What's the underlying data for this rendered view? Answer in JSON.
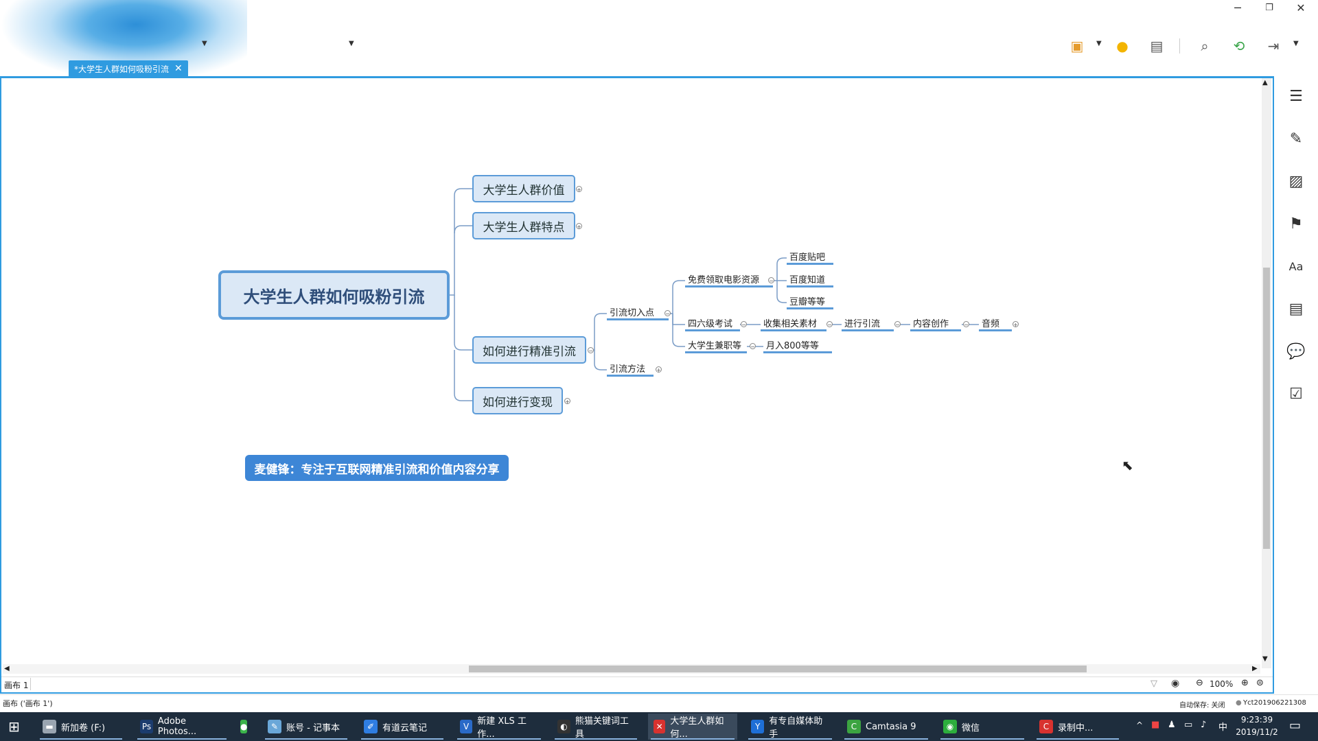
{
  "window": {
    "controls": [
      "─",
      "❐",
      "✕"
    ]
  },
  "tab": {
    "title": "*大学生人群如何吸粉引流",
    "close": "✕"
  },
  "mindmap": {
    "root": "大学生人群如何吸粉引流",
    "branches": [
      "大学生人群价值",
      "大学生人群特点",
      "如何进行精准引流",
      "如何进行变现"
    ],
    "sub": {
      "yinliu_rukou": "引流切入点",
      "yinliu_fangfa": "引流方法",
      "mianfei": "免费领取电影资源",
      "baidu_tieba": "百度贴吧",
      "baidu_zhidao": "百度知道",
      "douban": "豆瓣等等",
      "siliuji": "四六级考试",
      "shouji": "收集相关素材",
      "jinxing": "进行引流",
      "neirong": "内容创作",
      "yinpin": "音频",
      "jianzhi": "大学生兼职等",
      "yueru": "月入800等等"
    },
    "callout": "麦健锋：专注于互联网精准引流和价值内容分享"
  },
  "sheet": {
    "tab_label": "画布 1",
    "zoom": "100%"
  },
  "status": {
    "left": "画布 ('画布 1')",
    "autosave": "自动保存: 关闭",
    "user": "Yct201906221308"
  },
  "taskbar": {
    "items": [
      {
        "label": "新加卷 (F:)",
        "icon_color": "#9aa5b1",
        "glyph": "▬"
      },
      {
        "label": "Adobe Photos...",
        "icon_color": "#1c3c6e",
        "glyph": "Ps"
      },
      {
        "label": "",
        "icon_color": "#3bb34a",
        "glyph": "●"
      },
      {
        "label": "账号 - 记事本",
        "icon_color": "#6aa7d8",
        "glyph": "✎"
      },
      {
        "label": "有道云笔记",
        "icon_color": "#2f7de1",
        "glyph": "✐"
      },
      {
        "label": "新建 XLS 工作...",
        "icon_color": "#2a6ac8",
        "glyph": "V"
      },
      {
        "label": "熊猫关键词工具",
        "icon_color": "#333333",
        "glyph": "◐"
      },
      {
        "label": "大学生人群如何...",
        "icon_color": "#d8322f",
        "glyph": "✕"
      },
      {
        "label": "有专自媒体助手",
        "icon_color": "#1e6fd6",
        "glyph": "Y"
      },
      {
        "label": "Camtasia 9",
        "icon_color": "#3ca441",
        "glyph": "C"
      },
      {
        "label": "微信",
        "icon_color": "#2dae3d",
        "glyph": "◉"
      },
      {
        "label": "录制中...",
        "icon_color": "#d8322f",
        "glyph": "C"
      }
    ],
    "time": "9:23:39",
    "date": "2019/11/2",
    "ime": "中"
  }
}
